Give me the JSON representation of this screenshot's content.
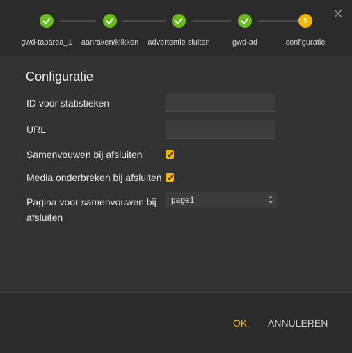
{
  "steps": [
    {
      "label": "gwd-taparea_1",
      "status": "done"
    },
    {
      "label": "aanraken/klikken",
      "status": "done"
    },
    {
      "label": "advertentie sluiten",
      "status": "done"
    },
    {
      "label": "gwd-ad",
      "status": "done"
    },
    {
      "label": "configuratie",
      "status": "current",
      "number": "5"
    }
  ],
  "dialog": {
    "title": "Configuratie",
    "close_icon": "close-icon",
    "fields": {
      "stats_id": {
        "label": "ID voor statistieken",
        "value": ""
      },
      "url": {
        "label": "URL",
        "value": ""
      },
      "collapse_on_close": {
        "label": "Samenvouwen bij afsluiten",
        "checked": true
      },
      "pause_media_on_close": {
        "label": "Media onderbreken bij afsluiten",
        "checked": true
      },
      "collapse_page": {
        "label_line1": "Pagina voor samenvouwen bij",
        "label_line2": "afsluiten",
        "value": "page1"
      }
    }
  },
  "footer": {
    "ok_label": "OK",
    "cancel_label": "ANNULEREN"
  },
  "colors": {
    "accent": "#f4b400",
    "done": "#6abb1e",
    "background": "#333333"
  }
}
